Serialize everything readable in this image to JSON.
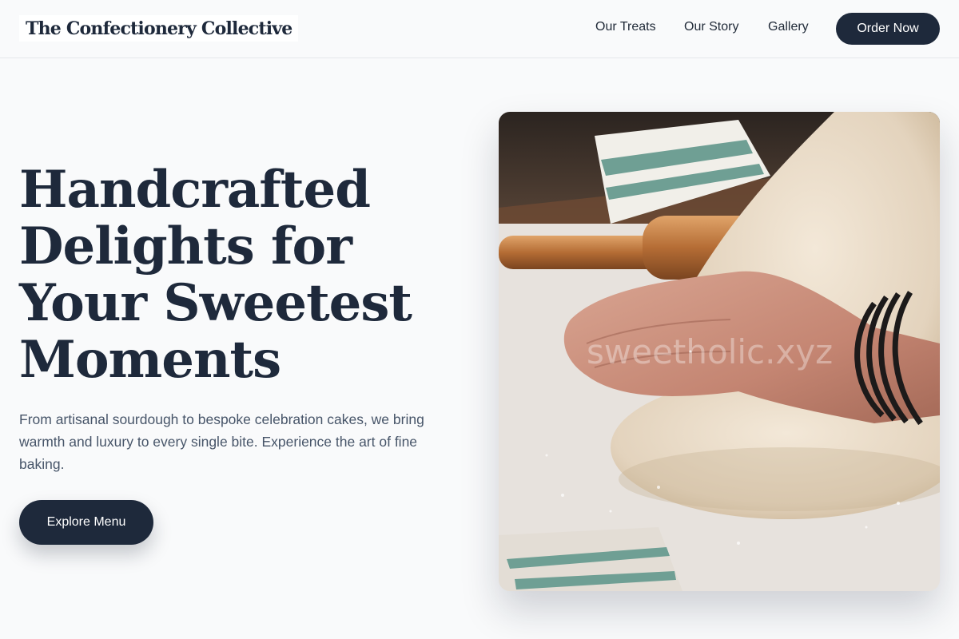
{
  "header": {
    "brand": "The Confectionery Collective",
    "nav": [
      {
        "label": "Our Treats"
      },
      {
        "label": "Our Story"
      },
      {
        "label": "Gallery"
      }
    ],
    "cta_label": "Order Now"
  },
  "hero": {
    "title_lines": [
      "Handcrafted",
      "Delights for",
      "Your Sweetest",
      "Moments"
    ],
    "description": "From artisanal sourdough to bespoke celebration cakes, we bring warmth and luxury to every single bite. Experience the art of fine baking.",
    "button_label": "Explore Menu",
    "image": {
      "subject": "hands kneading dough on a floured surface with rolling pin and striped towel",
      "watermark": "sweetholic.xyz"
    }
  },
  "colors": {
    "background": "#f9fafb",
    "primary": "#1e293b",
    "text_muted": "#475569",
    "button_text": "#ffffff"
  }
}
